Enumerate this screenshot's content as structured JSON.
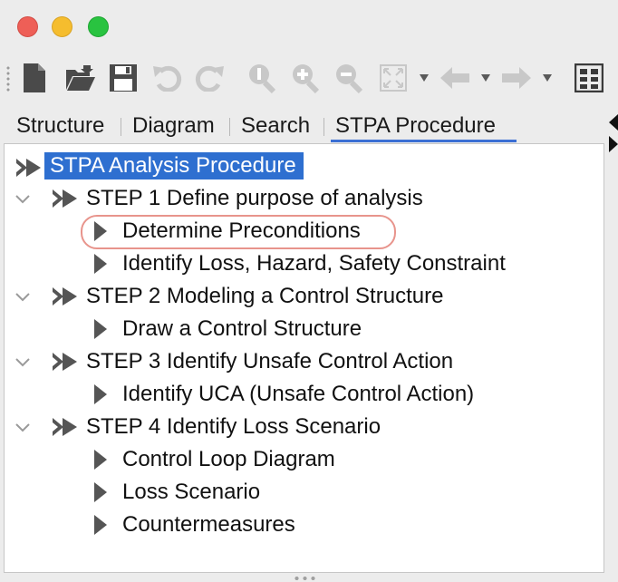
{
  "window": {
    "controls": [
      "close-button",
      "minimize-button",
      "maximize-button"
    ]
  },
  "toolbar": {
    "icons": [
      "new-document-icon",
      "open-folder-icon",
      "save-icon",
      "undo-icon",
      "redo-icon",
      "zoom-fit-icon",
      "zoom-in-icon",
      "zoom-out-icon",
      "fit-to-window-icon",
      "back-icon",
      "forward-icon",
      "diagram-layout-icon"
    ]
  },
  "tabs": [
    {
      "label": "Structure",
      "active": false
    },
    {
      "label": "Diagram",
      "active": false
    },
    {
      "label": "Search",
      "active": false
    },
    {
      "label": "STPA Procedure",
      "active": true
    }
  ],
  "tree": {
    "root": "STPA Analysis Procedure",
    "steps": [
      {
        "label": "STEP 1 Define purpose of analysis",
        "children": [
          "Determine Preconditions",
          "Identify Loss, Hazard, Safety Constraint"
        ]
      },
      {
        "label": "STEP 2 Modeling a Control Structure",
        "children": [
          "Draw a Control Structure"
        ]
      },
      {
        "label": "STEP 3 Identify Unsafe Control Action",
        "children": [
          "Identify UCA (Unsafe Control Action)"
        ]
      },
      {
        "label": "STEP 4 Identify Loss Scenario",
        "children": [
          "Control Loop Diagram",
          "Loss Scenario",
          "Countermeasures"
        ]
      }
    ],
    "highlighted_item": "Determine Preconditions"
  },
  "colors": {
    "selection": "#2e6fd0",
    "tab_underline": "#3b6fd4",
    "highlight_ring": "#e8948c"
  }
}
